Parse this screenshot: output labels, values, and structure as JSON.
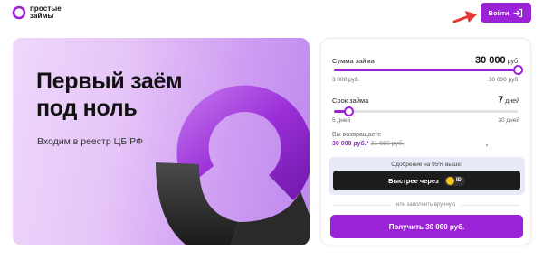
{
  "brand": {
    "line1": "простые",
    "line2": "займы",
    "accent": "#9b22d6"
  },
  "header": {
    "login_label": "Войти"
  },
  "hero": {
    "title_line1": "Первый заём",
    "title_line2": "под ноль",
    "subtitle": "Входим в реестр ЦБ РФ"
  },
  "calculator": {
    "amount": {
      "label": "Сумма займа",
      "value": "30 000",
      "unit": "руб.",
      "min": "3 000 руб.",
      "max": "30 000 руб.",
      "fill_fraction": 1.0
    },
    "term": {
      "label": "Срок займа",
      "value": "7",
      "unit": "дней",
      "min": "5 дней",
      "max": "30 дней",
      "fill_fraction": 0.08
    },
    "return": {
      "label": "Вы возвращаете",
      "value": "30 000 руб.*",
      "old_value": "31 680 руб."
    },
    "approval_text": "Одобрение на 95% выше:",
    "fast_label": "Быстрее через",
    "id_badge": "ID",
    "or_text": "или заполнить вручную",
    "get_label": "Получить 30 000 руб."
  }
}
